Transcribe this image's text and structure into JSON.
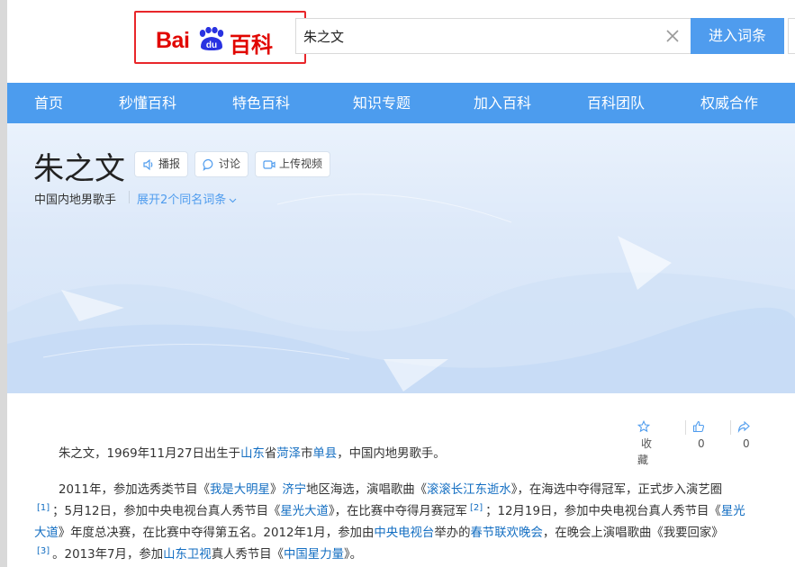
{
  "header": {
    "logo": {
      "text_bai": "Bai",
      "text_du": "du",
      "text_baike": "百科"
    },
    "search": {
      "value": "朱之文",
      "placeholder": ""
    },
    "search_button": "进入词条"
  },
  "nav": {
    "items": [
      {
        "label": "首页"
      },
      {
        "label": "秒懂百科"
      },
      {
        "label": "特色百科"
      },
      {
        "label": "知识专题"
      },
      {
        "label": "加入百科"
      },
      {
        "label": "百科团队"
      },
      {
        "label": "权威合作"
      }
    ]
  },
  "hero": {
    "title": "朱之文",
    "buttons": {
      "broadcast": "播报",
      "discuss": "讨论",
      "upload_video": "上传视频"
    },
    "subtitle": "中国内地男歌手",
    "expand": "展开2个同名词条"
  },
  "actions": {
    "favorite": "收藏",
    "like_count": "0",
    "share_count": "0"
  },
  "content": {
    "p1": {
      "t1": "朱之文，1969年11月27日出生于",
      "l1": "山东",
      "t2": "省",
      "l2": "菏泽",
      "t3": "市",
      "l3": "单县",
      "t4": "，中国内地男歌手。"
    },
    "p2": {
      "t1": "2011年，参加选秀类节目《",
      "l1": "我是大明星",
      "t2": "》",
      "l2": "济宁",
      "t3": "地区海选，演唱歌曲《",
      "l3": "滚滚长江东逝水",
      "t4": "》，在海选中夺得冠军，正式步入演艺圈",
      "r1": "[1]",
      "t5": "；5月12日，参加中央电视台真人秀节目《",
      "l4": "星光大道",
      "t6": "》，在比赛中夺得月赛冠军",
      "r2": "[2]",
      "t7": "；12月19日，参加中央电视台真人秀节目《",
      "l5": "星光大道",
      "t8": "》年度总决赛，在比赛中夺得第五名。2012年1月，参加由",
      "l6": "中央电视台",
      "t9": "举办的",
      "l7": "春节联欢晚会",
      "t10": "，在晚会上演唱歌曲《我要回家》",
      "r3": "[3]",
      "t11": "。2013年7月，参加",
      "l8": "山东卫视",
      "t12": "真人秀节目《",
      "l9": "中国星力量",
      "t13": "》。"
    }
  },
  "colors": {
    "brand_red": "#e10601",
    "nav_blue": "#4c9cee",
    "link_blue": "#136ec2",
    "annotation_red": "#e8262a"
  }
}
